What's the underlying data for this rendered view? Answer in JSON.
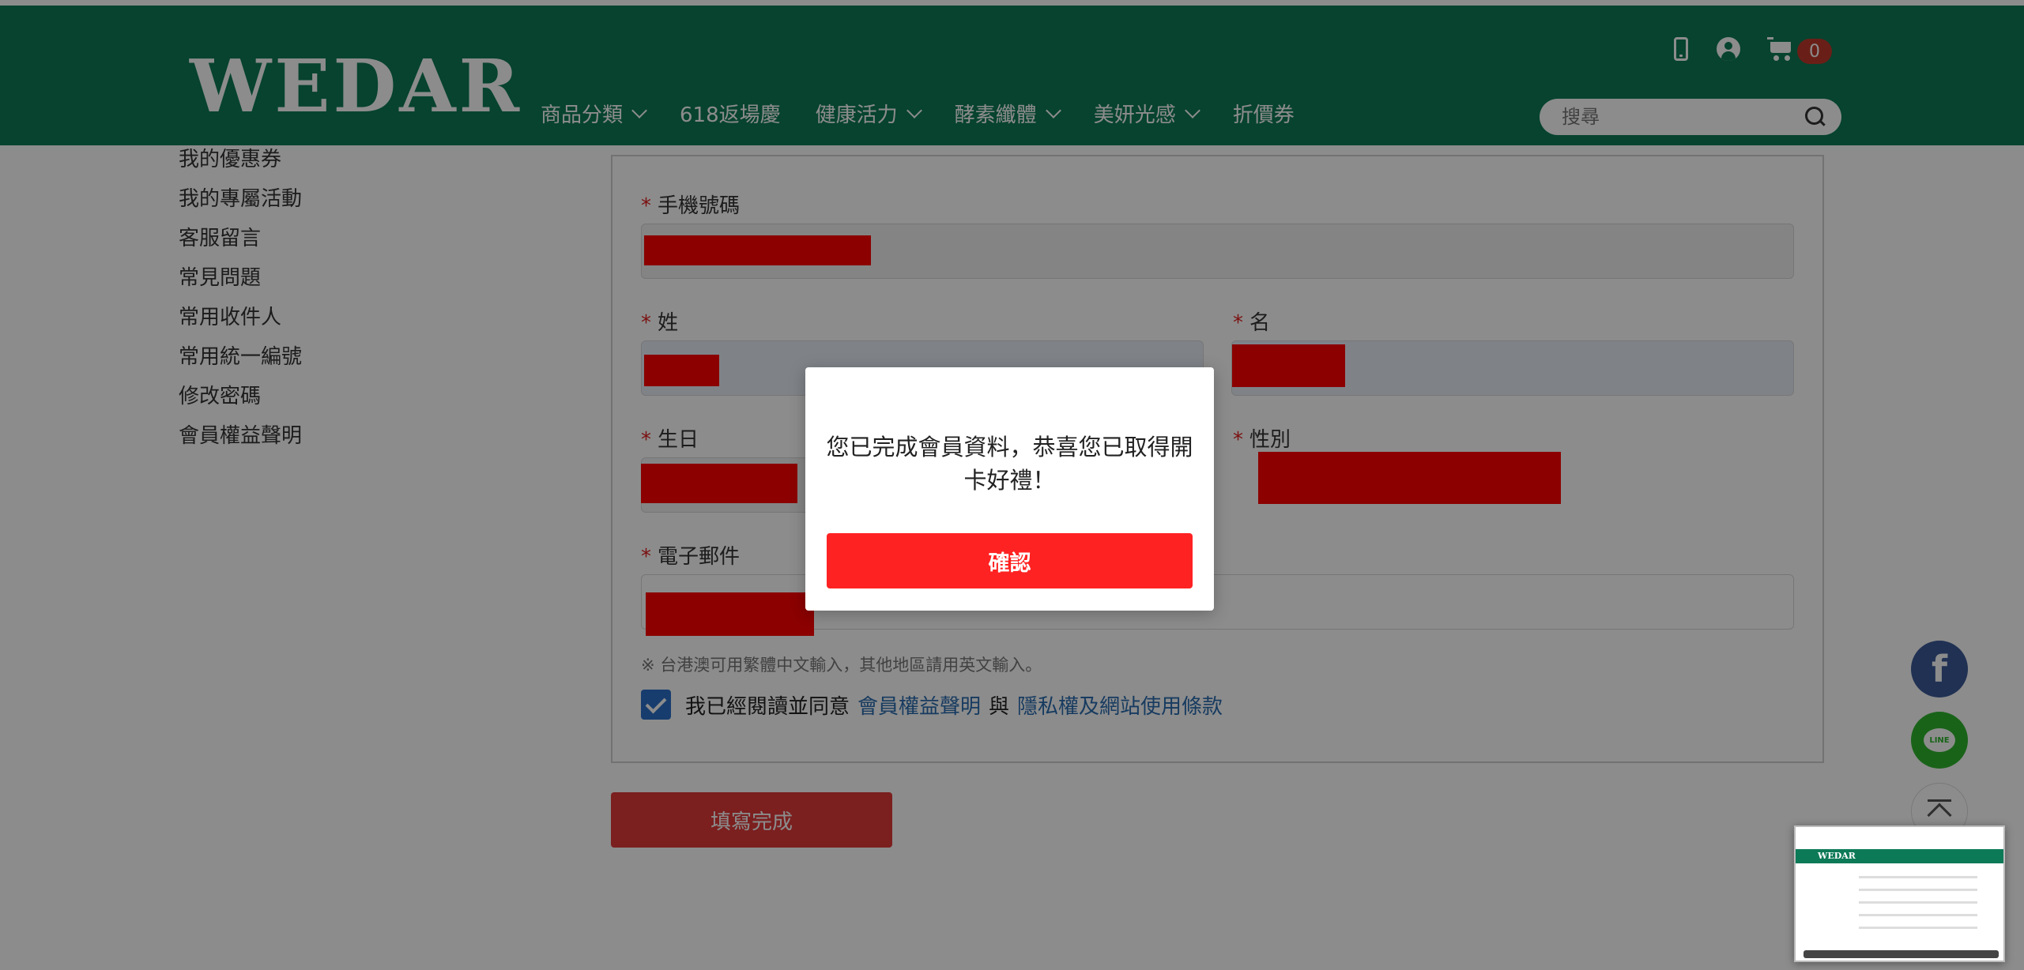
{
  "header": {
    "logo": "WEDAR",
    "nav": [
      {
        "label": "商品分類",
        "has_dropdown": true
      },
      {
        "label": "618返場慶",
        "has_dropdown": false
      },
      {
        "label": "健康活力",
        "has_dropdown": true
      },
      {
        "label": "酵素纖體",
        "has_dropdown": true
      },
      {
        "label": "美妍光感",
        "has_dropdown": true
      },
      {
        "label": "折價券",
        "has_dropdown": false
      }
    ],
    "icons": [
      "mobile-icon",
      "user-icon",
      "cart-icon"
    ],
    "cart_count": "0",
    "search_placeholder": "搜尋",
    "bg_color": "#0d7a57"
  },
  "sidebar": {
    "items": [
      {
        "label": "我的優惠券"
      },
      {
        "label": "我的專屬活動"
      },
      {
        "label": "客服留言"
      },
      {
        "label": "常見問題"
      },
      {
        "label": "常用收件人"
      },
      {
        "label": "常用統一編號"
      },
      {
        "label": "修改密碼"
      },
      {
        "label": "會員權益聲明"
      }
    ]
  },
  "form": {
    "required_mark": "*",
    "phone_label": "手機號碼",
    "last_name_label": "姓",
    "first_name_label": "名",
    "birthday_label": "生日",
    "gender_label": "性別",
    "email_label": "電子郵件",
    "note": "※ 台港澳可用繁體中文輸入，其他地區請用英文輸入。",
    "agree_prefix": "我已經閱讀並同意",
    "agree_link1": "會員權益聲明",
    "agree_and": "與",
    "agree_link2": "隱私權及網站使用條款",
    "agree_checked": true,
    "submit_label": "填寫完成"
  },
  "social": {
    "facebook_glyph": "f",
    "line_label": "LINE"
  },
  "modal": {
    "message": "您已完成會員資料，恭喜您已取得開卡好禮！",
    "confirm_label": "確認",
    "confirm_color": "#ff2222"
  },
  "thumbnail": {
    "logo": "WEDAR"
  }
}
